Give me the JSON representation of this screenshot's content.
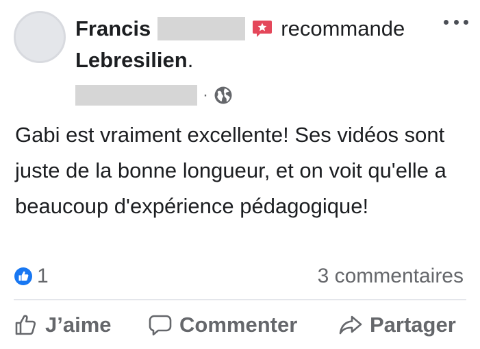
{
  "post": {
    "author_first_name": "Francis",
    "recommend_text": "recommande",
    "page_name": "Lebresilien",
    "page_name_suffix": ".",
    "meta_separator": "·",
    "body": "Gabi est vraiment excellente! Ses vidéos sont juste de la bonne longueur, et on voit qu'elle a beaucoup d'expérience pédagogique!"
  },
  "engagement": {
    "like_count": "1",
    "comments_label": "3 commentaires"
  },
  "actions": {
    "like_label": "J’aime",
    "comment_label": "Commenter",
    "share_label": "Partager"
  },
  "icons": {
    "recommend": "recommend-star-icon",
    "privacy": "globe-icon",
    "like_badge": "like-badge-icon",
    "like_action": "thumbs-up-icon",
    "comment_action": "comment-bubble-icon",
    "share_action": "share-arrow-icon",
    "more": "more-options-icon"
  },
  "colors": {
    "text_primary": "#1c1e21",
    "text_secondary": "#65676b",
    "recommend_red": "#e4475a",
    "like_blue": "#1877f2",
    "redaction_gray": "#d6d6d6"
  }
}
